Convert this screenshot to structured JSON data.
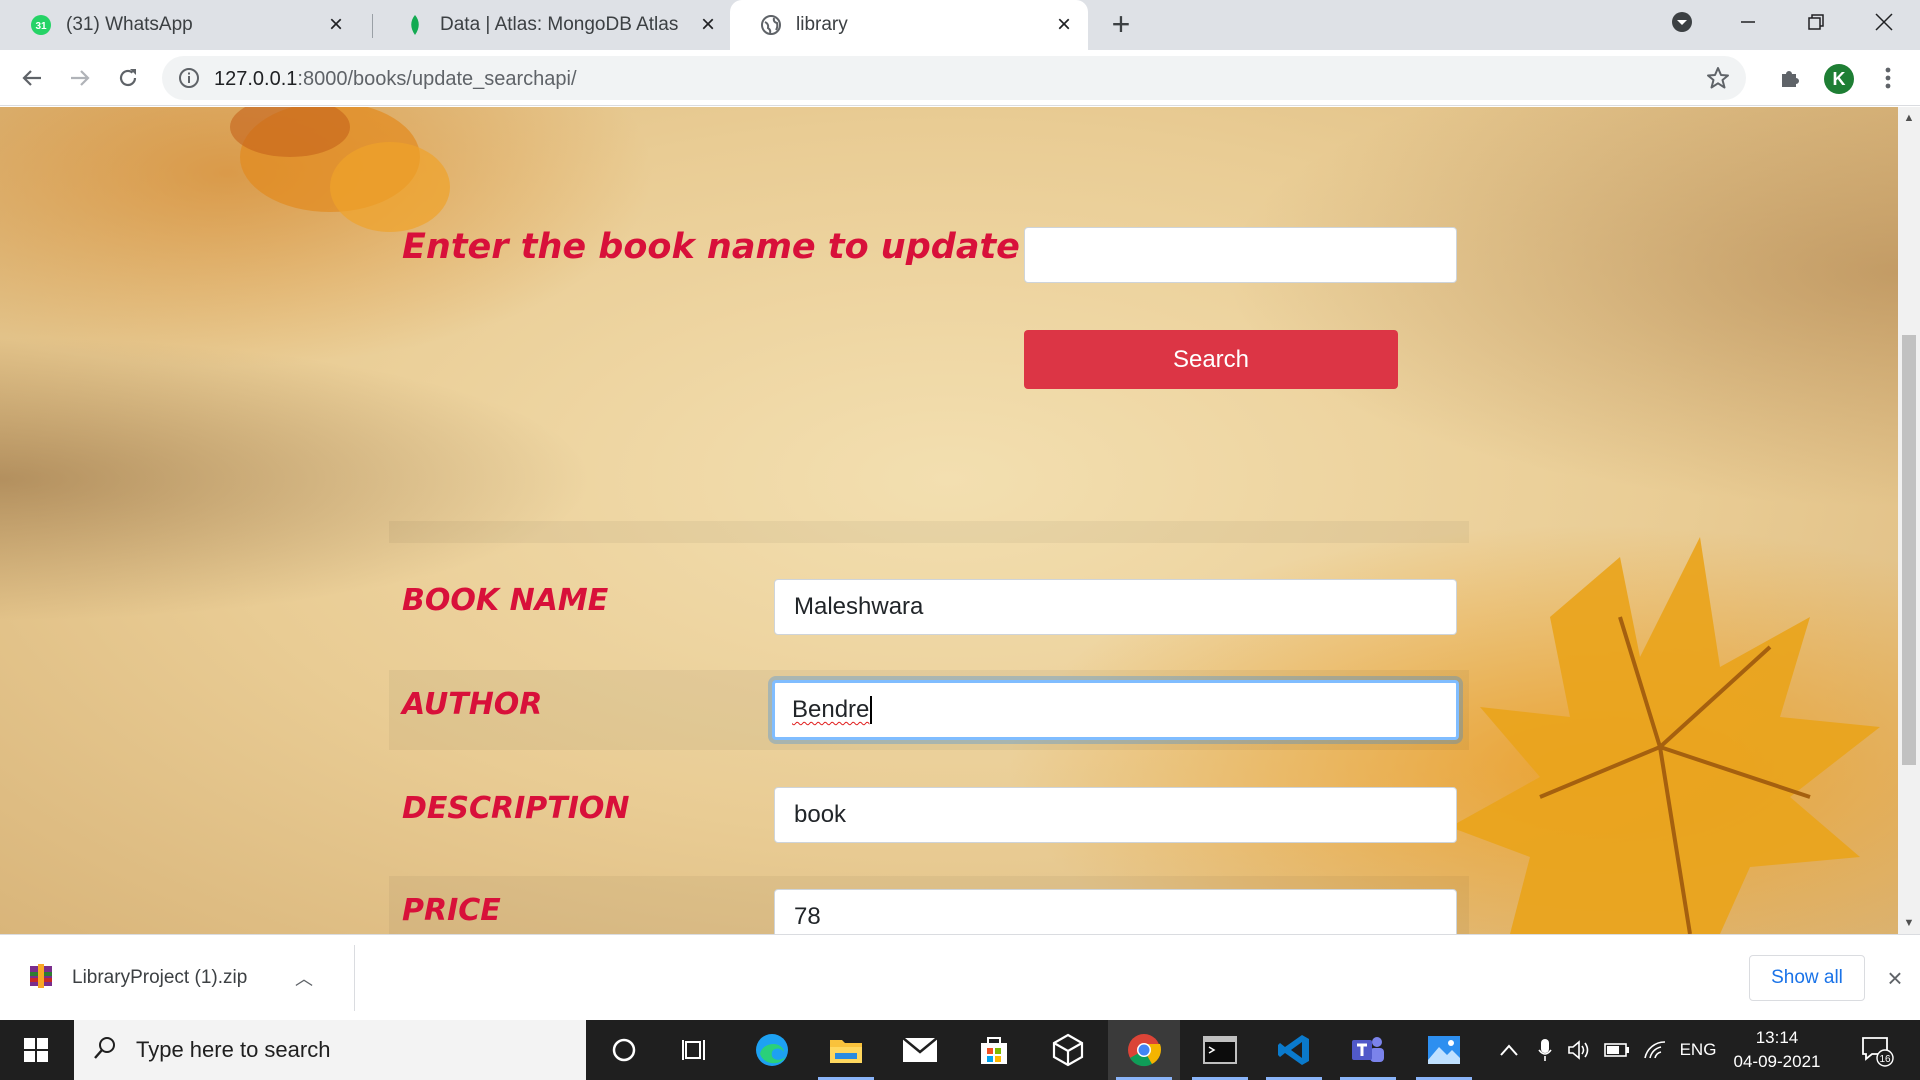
{
  "browser": {
    "tabs": [
      {
        "title": "(31) WhatsApp",
        "favicon": "whatsapp-icon",
        "badge": "31",
        "active": false
      },
      {
        "title": "Data | Atlas: MongoDB Atlas",
        "favicon": "mongodb-leaf-icon",
        "active": false
      },
      {
        "title": "library",
        "favicon": "globe-icon",
        "active": true
      }
    ],
    "url_host": "127.0.0.1",
    "url_path": ":8000/books/update_searchapi/",
    "profile_initial": "K"
  },
  "page": {
    "search_prompt": "Enter the book name to update",
    "search_value": "",
    "search_button": "Search",
    "fields": [
      {
        "label": "BOOK NAME",
        "value": "Maleshwara"
      },
      {
        "label": "AUTHOR",
        "value": "Bendre"
      },
      {
        "label": "DESCRIPTION",
        "value": "book"
      },
      {
        "label": "PRICE",
        "value": "78"
      }
    ]
  },
  "downloads": {
    "file_name": "LibraryProject (1).zip",
    "show_all": "Show all"
  },
  "taskbar": {
    "search_placeholder": "Type here to search",
    "language": "ENG",
    "time": "13:14",
    "date": "04-09-2021",
    "notification_count": "16"
  },
  "colors": {
    "label_red": "#d8103a",
    "button_red": "#dc3545",
    "focus_ring": "#80bdff"
  }
}
